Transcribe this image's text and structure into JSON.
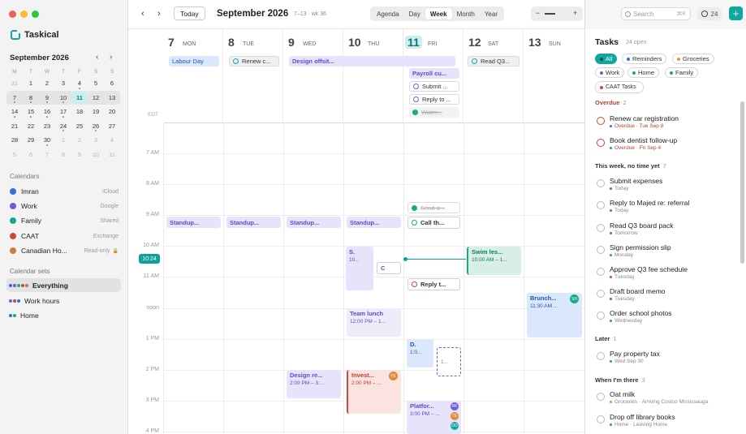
{
  "sidebar": {
    "app_name": "Taskical",
    "minical": {
      "title": "September 2026",
      "prev": "‹",
      "next": "›",
      "weekdays": [
        "M",
        "T",
        "W",
        "T",
        "F",
        "S",
        "S"
      ],
      "weeks": [
        [
          "31",
          "1",
          "2",
          "3",
          "4",
          "5",
          "6"
        ],
        [
          "7",
          "8",
          "9",
          "10",
          "11",
          "12",
          "13"
        ],
        [
          "14",
          "15",
          "16",
          "17",
          "18",
          "19",
          "20"
        ],
        [
          "21",
          "22",
          "23",
          "24",
          "25",
          "26",
          "27"
        ],
        [
          "28",
          "29",
          "30",
          "1",
          "2",
          "3",
          "4"
        ],
        [
          "5",
          "6",
          "7",
          "8",
          "9",
          "10",
          "11"
        ]
      ]
    },
    "calendars_title": "Calendars",
    "calendars": [
      {
        "name": "Imran",
        "source": "iCloud",
        "color": "#2f6fe0"
      },
      {
        "name": "Work",
        "source": "Google",
        "color": "#6b5ed6"
      },
      {
        "name": "Family",
        "source": "Shared",
        "color": "#16a98c"
      },
      {
        "name": "CAAT",
        "source": "Exchange",
        "color": "#d0463a"
      },
      {
        "name": "Canadian Ho...",
        "source": "Read-only",
        "color": "#d07a3a"
      }
    ],
    "sets_title": "Calendar sets",
    "sets": [
      {
        "name": "Everything"
      },
      {
        "name": "Work hours"
      },
      {
        "name": "Home"
      }
    ]
  },
  "toolbar": {
    "prev": "‹",
    "next": "›",
    "today": "Today",
    "title": "September 2026",
    "subtitle": "7–13 · wk 36",
    "views": [
      "Agenda",
      "Day",
      "Week",
      "Month",
      "Year"
    ],
    "active_view": "Week",
    "zoom_minus": "−",
    "zoom_plus": "+",
    "search_placeholder": "Search",
    "search_kbd": "⌘K",
    "open_count": "24",
    "add": "+"
  },
  "days": [
    {
      "num": "7",
      "name": "MON"
    },
    {
      "num": "8",
      "name": "TUE"
    },
    {
      "num": "9",
      "name": "WED"
    },
    {
      "num": "10",
      "name": "THU"
    },
    {
      "num": "11",
      "name": "FRI"
    },
    {
      "num": "12",
      "name": "SAT"
    },
    {
      "num": "13",
      "name": "SUN"
    }
  ],
  "timezone": "EDT",
  "hours": [
    "7 AM",
    "8 AM",
    "9 AM",
    "10 AM",
    "11 AM",
    "noon",
    "1 PM",
    "2 PM",
    "3 PM",
    "4 PM"
  ],
  "now_label": "10:24",
  "allday": {
    "labour_day": "Labour Day",
    "renew": "Renew c...",
    "design_offsite": "Design offsit...",
    "read_q3": "Read Q3...",
    "payroll": "Payroll cu...",
    "submit": "Submit ...",
    "reply": "Reply to ...",
    "water": "Water..."
  },
  "events": {
    "standup": "Standup...",
    "send": "Send a...",
    "callthe": "Call th...",
    "s_title": "S.",
    "s_time": "10...",
    "c_title": "C",
    "reply_t": "Reply t...",
    "swim_title": "Swim les...",
    "swim_time": "10:00 AM – 1...",
    "brunch_title": "Brunch...",
    "brunch_time": "11:30 AM ...",
    "brunch_badge": "SH",
    "lunch_title": "Team lunch",
    "lunch_time": "12:00 PM – 1...",
    "d_title": "D.",
    "d_time": "1:0...",
    "dash_time": "1...",
    "design_re_title": "Design re...",
    "design_re_time": "2:00 PM – 3:...",
    "invest_title": "Invest...",
    "invest_time": "2:00 PM – ...",
    "invest_badge": "TE",
    "platform_title": "Platfor...",
    "platform_time": "3:00 PM – ...",
    "platform_badges": [
      "RK",
      "TE",
      "DO"
    ]
  },
  "tasks": {
    "title": "Tasks",
    "count": "24 open",
    "filters": [
      {
        "label": "All",
        "color": "#0b4c4a",
        "on": true
      },
      {
        "label": "Reminders",
        "color": "#2f6fe0"
      },
      {
        "label": "Groceries",
        "color": "#e0a020"
      },
      {
        "label": "Work",
        "color": "#6b5ed6"
      },
      {
        "label": "Home",
        "color": "#16a3a3"
      },
      {
        "label": "Family",
        "color": "#16a98c"
      },
      {
        "label": "CAAT Tasks",
        "color": "#d0463a"
      }
    ],
    "groups": {
      "overdue": {
        "label": "Overdue",
        "count": "2"
      },
      "week": {
        "label": "This week, no time yet",
        "count": "7"
      },
      "later": {
        "label": "Later",
        "count": "1"
      },
      "there": {
        "label": "When I'm there",
        "count": "3"
      }
    },
    "items": [
      {
        "title": "Renew car registration",
        "meta": "Overdue · Tue Sep 8"
      },
      {
        "title": "Book dentist follow-up",
        "meta": "Overdue · Fri Sep 4"
      },
      {
        "title": "Submit expenses",
        "meta": "Today"
      },
      {
        "title": "Reply to Majed re: referral",
        "meta": "Today"
      },
      {
        "title": "Read Q3 board pack",
        "meta": "Tomorrow"
      },
      {
        "title": "Sign permission slip",
        "meta": "Monday"
      },
      {
        "title": "Approve Q3 fee schedule",
        "meta": "Tuesday"
      },
      {
        "title": "Draft board memo",
        "meta": "Tuesday"
      },
      {
        "title": "Order school photos",
        "meta": "Wednesday"
      },
      {
        "title": "Pay property tax",
        "meta": "Wed Sep 30"
      },
      {
        "title": "Oat milk",
        "meta": "Groceries · Arriving Costco Mississauga"
      },
      {
        "title": "Drop off library books",
        "meta": "Home · Leaving Home"
      }
    ]
  },
  "colors": {
    "accent": "#10a6a0",
    "work": "#6b5ed6",
    "family": "#16a98c",
    "imran": "#2f6fe0",
    "caat": "#d0463a",
    "holiday": "#d07a3a"
  }
}
